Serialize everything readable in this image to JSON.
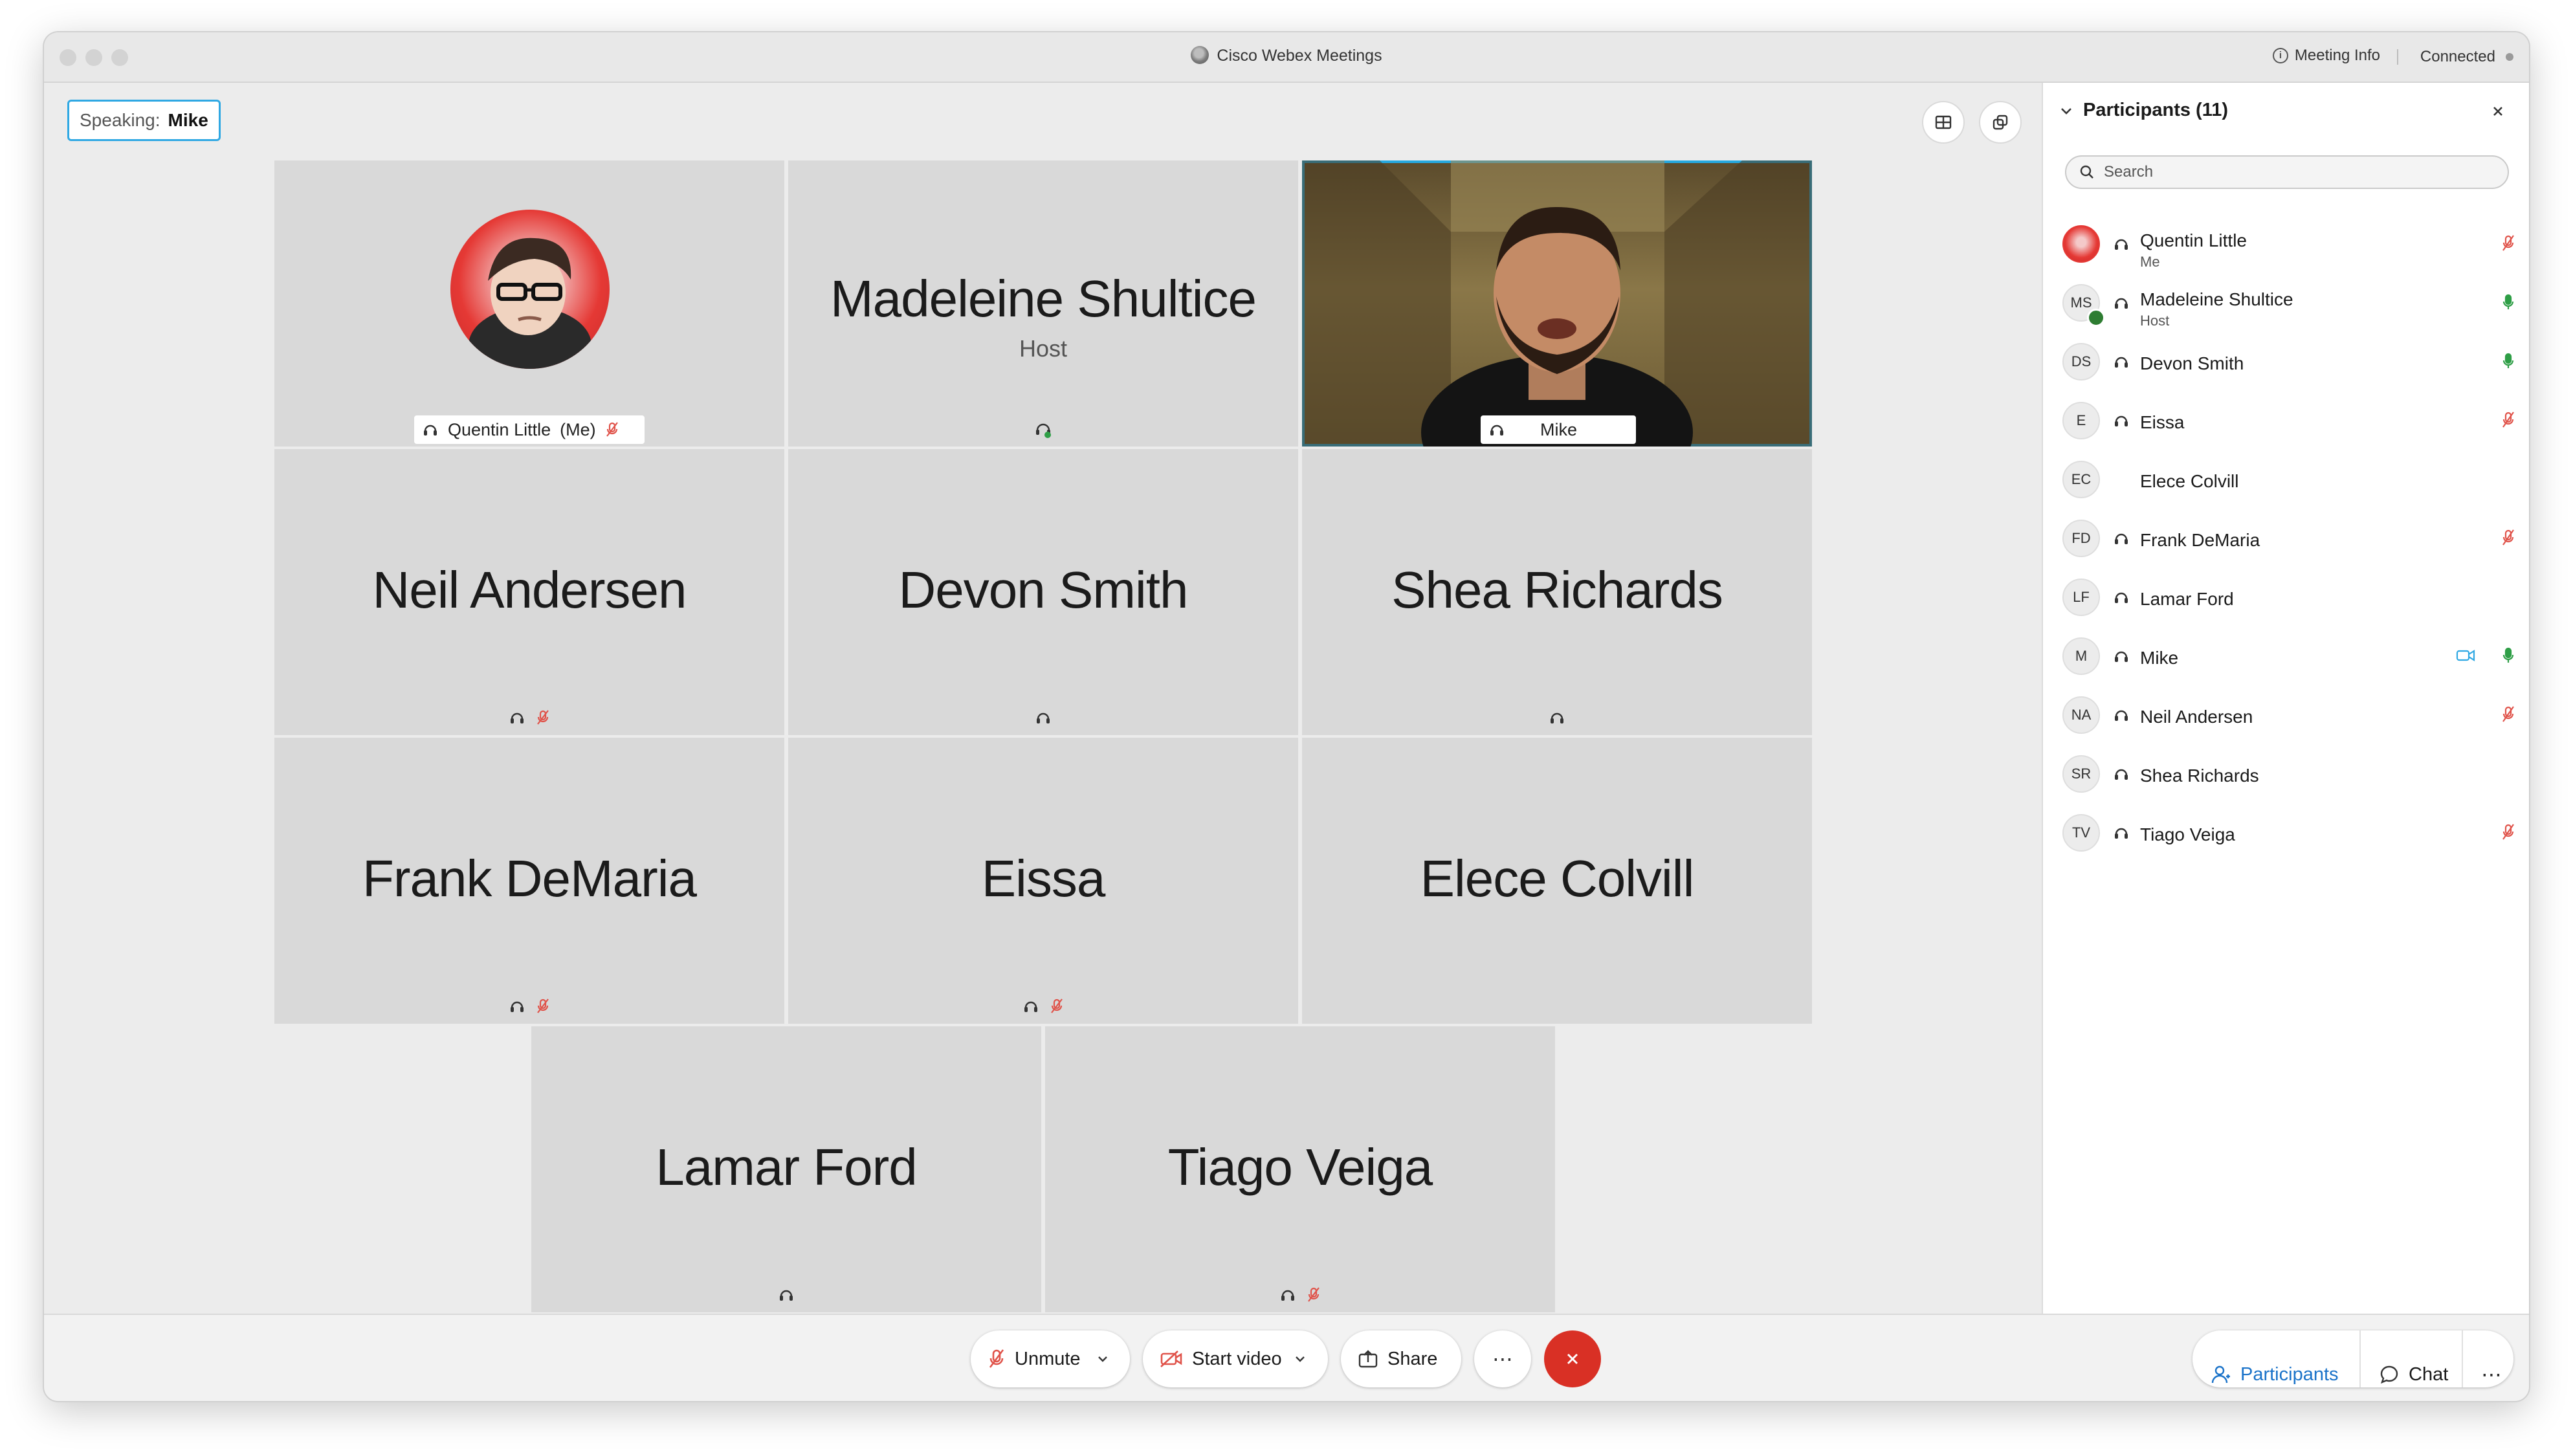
{
  "window": {
    "title": "Cisco Webex Meetings",
    "meeting_info": "Meeting Info",
    "connection_status": "Connected"
  },
  "speaking": {
    "label": "Speaking:",
    "name": "Mike"
  },
  "tiles": [
    {
      "name": "Quentin Little",
      "suffix": "(Me)",
      "has_avatar": true,
      "muted": true
    },
    {
      "name": "Madeleine Shultice",
      "role": "Host"
    },
    {
      "name": "Mike",
      "video": true
    },
    {
      "name": "Neil Andersen",
      "muted": true
    },
    {
      "name": "Devon Smith"
    },
    {
      "name": "Shea Richards"
    },
    {
      "name": "Frank DeMaria",
      "muted": true
    },
    {
      "name": "Eissa",
      "muted": true
    },
    {
      "name": "Elece Colvill"
    },
    {
      "name": "Lamar Ford"
    },
    {
      "name": "Tiago Veiga",
      "muted": true
    }
  ],
  "panel": {
    "title": "Participants (11)",
    "search_placeholder": "Search",
    "participants": [
      {
        "initials": "",
        "name": "Quentin Little",
        "role": "Me",
        "audio": "muted",
        "photo": true
      },
      {
        "initials": "MS",
        "name": "Madeleine Shultice",
        "role": "Host",
        "audio": "unmuted"
      },
      {
        "initials": "DS",
        "name": "Devon Smith",
        "role": "",
        "audio": "unmuted"
      },
      {
        "initials": "E",
        "name": "Eissa",
        "role": "",
        "audio": "muted"
      },
      {
        "initials": "EC",
        "name": "Elece Colvill",
        "role": "",
        "audio": "none"
      },
      {
        "initials": "FD",
        "name": "Frank DeMaria",
        "role": "",
        "audio": "muted"
      },
      {
        "initials": "LF",
        "name": "Lamar Ford",
        "role": "",
        "audio": "none"
      },
      {
        "initials": "M",
        "name": "Mike",
        "role": "",
        "audio": "unmuted",
        "video": true
      },
      {
        "initials": "NA",
        "name": "Neil Andersen",
        "role": "",
        "audio": "muted"
      },
      {
        "initials": "SR",
        "name": "Shea Richards",
        "role": "",
        "audio": "none"
      },
      {
        "initials": "TV",
        "name": "Tiago Veiga",
        "role": "",
        "audio": "muted"
      }
    ]
  },
  "controls": {
    "unmute": "Unmute",
    "start_video": "Start video",
    "share": "Share",
    "more": "⋯",
    "participants": "Participants",
    "chat": "Chat"
  },
  "colors": {
    "accent": "#2fa8e3",
    "end_call": "#d93025",
    "muted": "#e0534a",
    "unmuted": "#2e9e46"
  }
}
